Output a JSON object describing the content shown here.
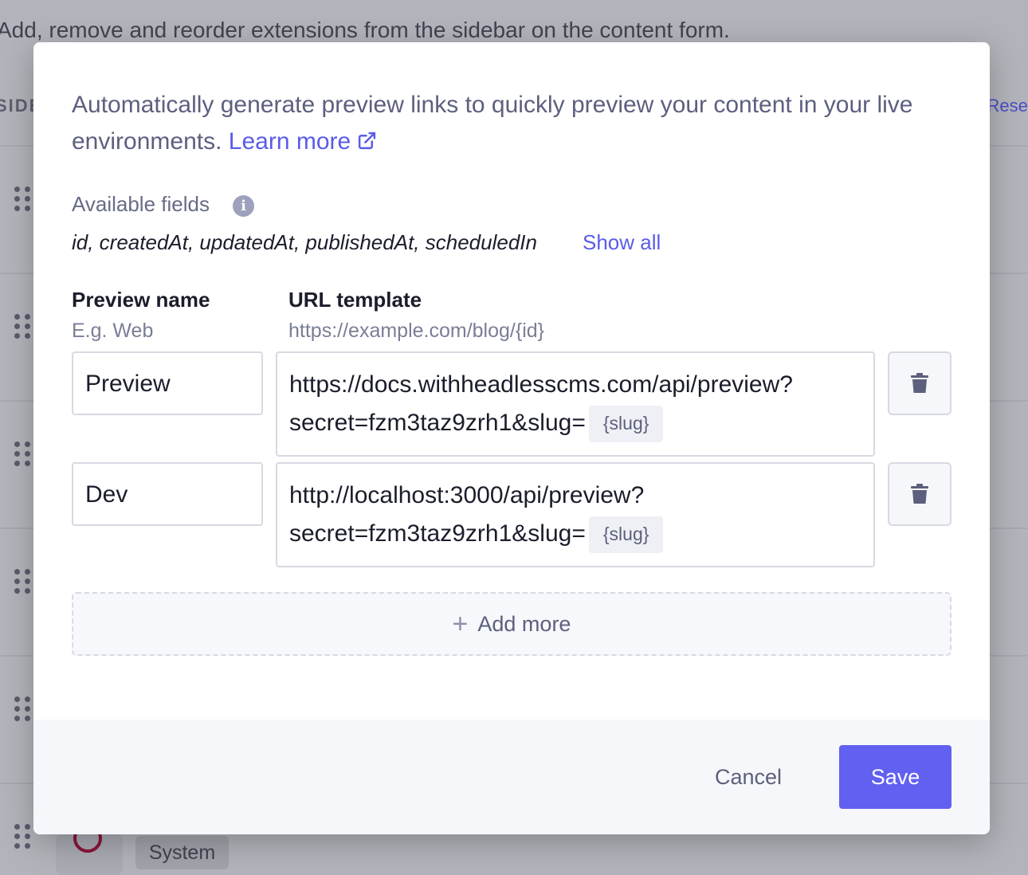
{
  "background": {
    "description": "Add, remove and reorder extensions from the sidebar on the content form.",
    "sidebar_heading": "SIDE",
    "reset_label": "Reset",
    "badge_label": "System"
  },
  "modal": {
    "intro_text": "Automatically generate preview links to quickly preview your content in your live environments.",
    "learn_more_label": "Learn more",
    "available_fields_label": "Available fields",
    "available_fields_list": "id, createdAt, updatedAt, publishedAt, scheduledIn",
    "show_all_label": "Show all",
    "columns": {
      "name_header": "Preview name",
      "name_hint": "E.g. Web",
      "url_header": "URL template",
      "url_hint": "https://example.com/blog/{id}"
    },
    "previews": [
      {
        "name": "Preview",
        "url_line1": "https://docs.withheadlesscms.com/api/preview?",
        "url_line2": "secret=fzm3taz9zrh1&slug=",
        "tag": "{slug}"
      },
      {
        "name": "Dev",
        "url_line1": "http://localhost:3000/api/preview?",
        "url_line2": "secret=fzm3taz9zrh1&slug=",
        "tag": "{slug}"
      }
    ],
    "add_more_label": "Add more",
    "cancel_label": "Cancel",
    "save_label": "Save"
  },
  "colors": {
    "accent": "#6160f0",
    "link": "#5a5ce8",
    "overlay": "#b3b4bb"
  },
  "icons": {
    "external": "external-link-icon",
    "info": "info-icon",
    "delete": "trash-icon",
    "add": "plus-icon",
    "drag": "drag-handle-icon"
  }
}
